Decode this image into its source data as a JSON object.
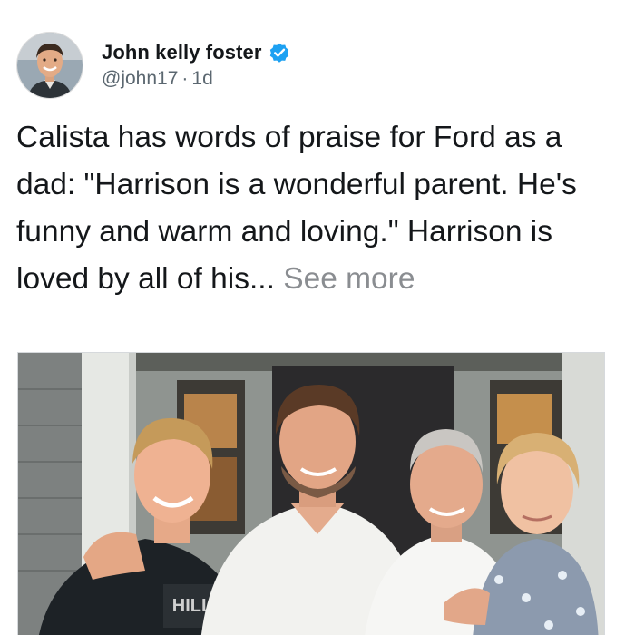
{
  "author": {
    "name": "John kelly foster",
    "handle": "@john17",
    "separator": "·",
    "time": "1d",
    "verified": true
  },
  "post": {
    "text": "Calista has words of praise for Ford as a dad: \"Harrison is a wonderful parent. He's funny and warm and loving.\" Harrison is loved by all of his...",
    "see_more_label": "See more"
  },
  "photo": {
    "shirt_print": "HILL"
  },
  "icons": {
    "verified_badge": "verified-check-icon"
  },
  "colors": {
    "verified_blue": "#1da1f2",
    "text": "#14171a",
    "muted": "#5b6770",
    "see_more": "#8a8d91"
  }
}
